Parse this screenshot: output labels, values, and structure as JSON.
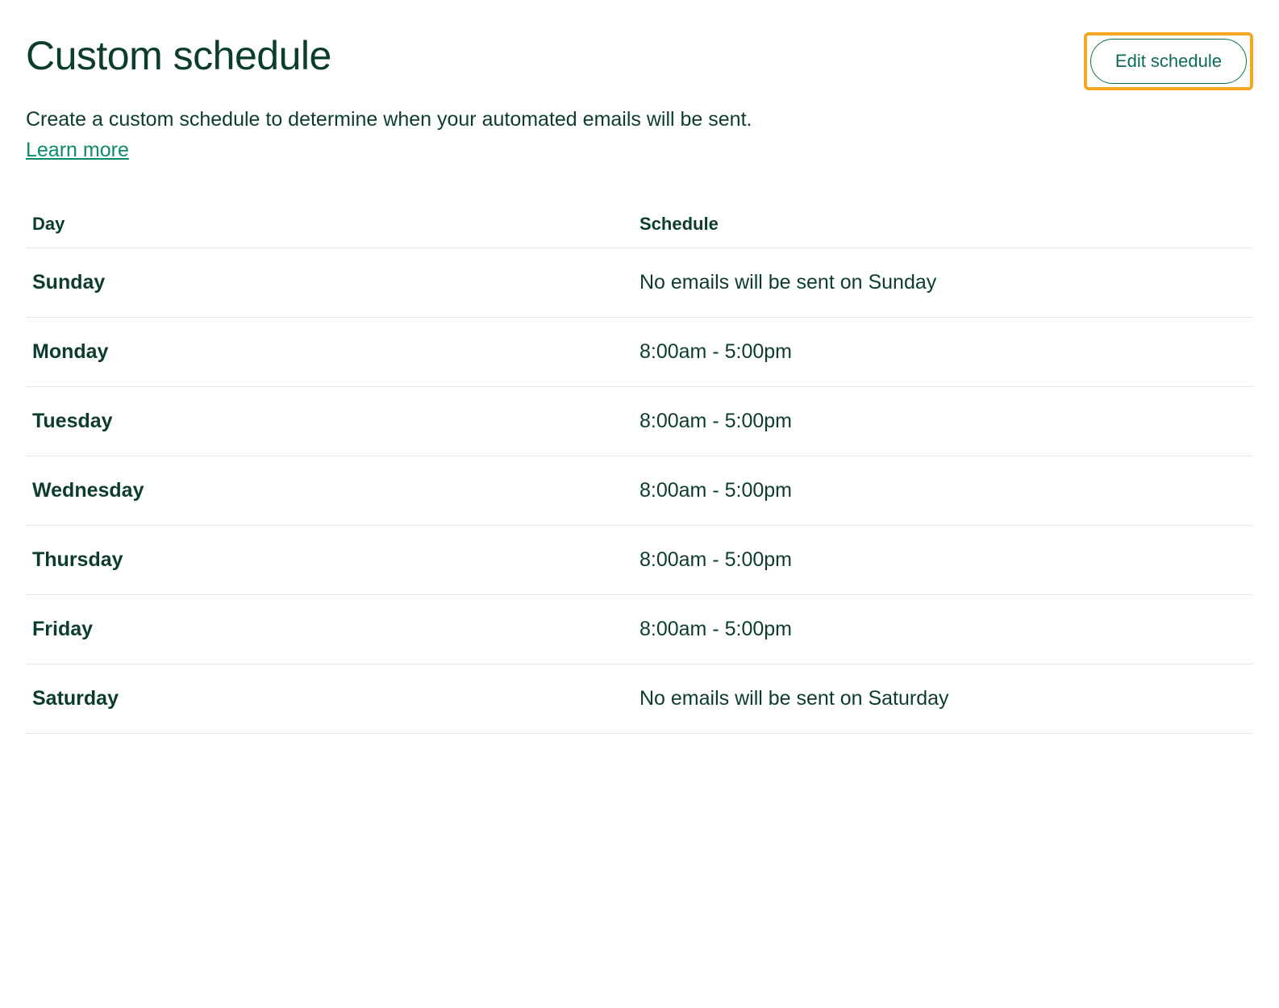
{
  "header": {
    "title": "Custom schedule",
    "edit_button_label": "Edit schedule"
  },
  "description": "Create a custom schedule to determine when your automated emails will be sent.",
  "learn_more_label": "Learn more",
  "table": {
    "headers": {
      "day": "Day",
      "schedule": "Schedule"
    },
    "rows": [
      {
        "day": "Sunday",
        "schedule": "No emails will be sent on Sunday"
      },
      {
        "day": "Monday",
        "schedule": "8:00am - 5:00pm"
      },
      {
        "day": "Tuesday",
        "schedule": "8:00am - 5:00pm"
      },
      {
        "day": "Wednesday",
        "schedule": "8:00am - 5:00pm"
      },
      {
        "day": "Thursday",
        "schedule": "8:00am - 5:00pm"
      },
      {
        "day": "Friday",
        "schedule": "8:00am - 5:00pm"
      },
      {
        "day": "Saturday",
        "schedule": "No emails will be sent on Saturday"
      }
    ]
  }
}
